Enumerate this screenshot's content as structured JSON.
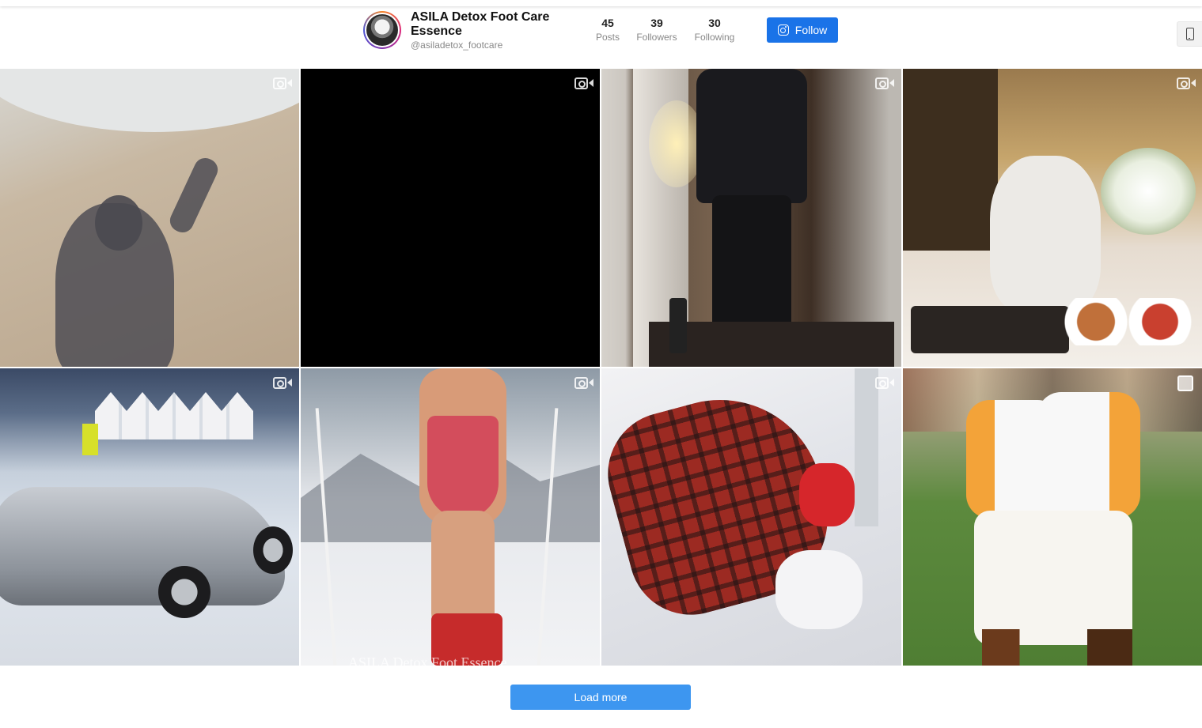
{
  "profile": {
    "name": "ASILA Detox Foot Care Essence",
    "handle": "@asiladetox_footcare"
  },
  "stats": [
    {
      "value": "45",
      "label": "Posts"
    },
    {
      "value": "39",
      "label": "Followers"
    },
    {
      "value": "30",
      "label": "Following"
    }
  ],
  "actions": {
    "follow_label": "Follow",
    "load_more_label": "Load more"
  },
  "icons": {
    "follow": "instagram-icon",
    "mobile_toggle": "phone-icon",
    "post_video": "video-camera-icon",
    "post_carousel": "carousel-icon"
  },
  "colors": {
    "follow_button": "#1a73e8",
    "load_more_button": "#3d96f0"
  },
  "posts": [
    {
      "type": "video",
      "subject": "beach-shadow"
    },
    {
      "type": "video",
      "subject": "black-frame"
    },
    {
      "type": "video",
      "subject": "mirror-selfie"
    },
    {
      "type": "video",
      "subject": "hotel-breakfast"
    },
    {
      "type": "video",
      "subject": "silver-convertible"
    },
    {
      "type": "video",
      "subject": "skier-swimsuit",
      "caption_overlay": "ASILA Detox Foot Essence"
    },
    {
      "type": "video",
      "subject": "tartan-blanket-group"
    },
    {
      "type": "carousel",
      "subject": "polo-players"
    }
  ]
}
